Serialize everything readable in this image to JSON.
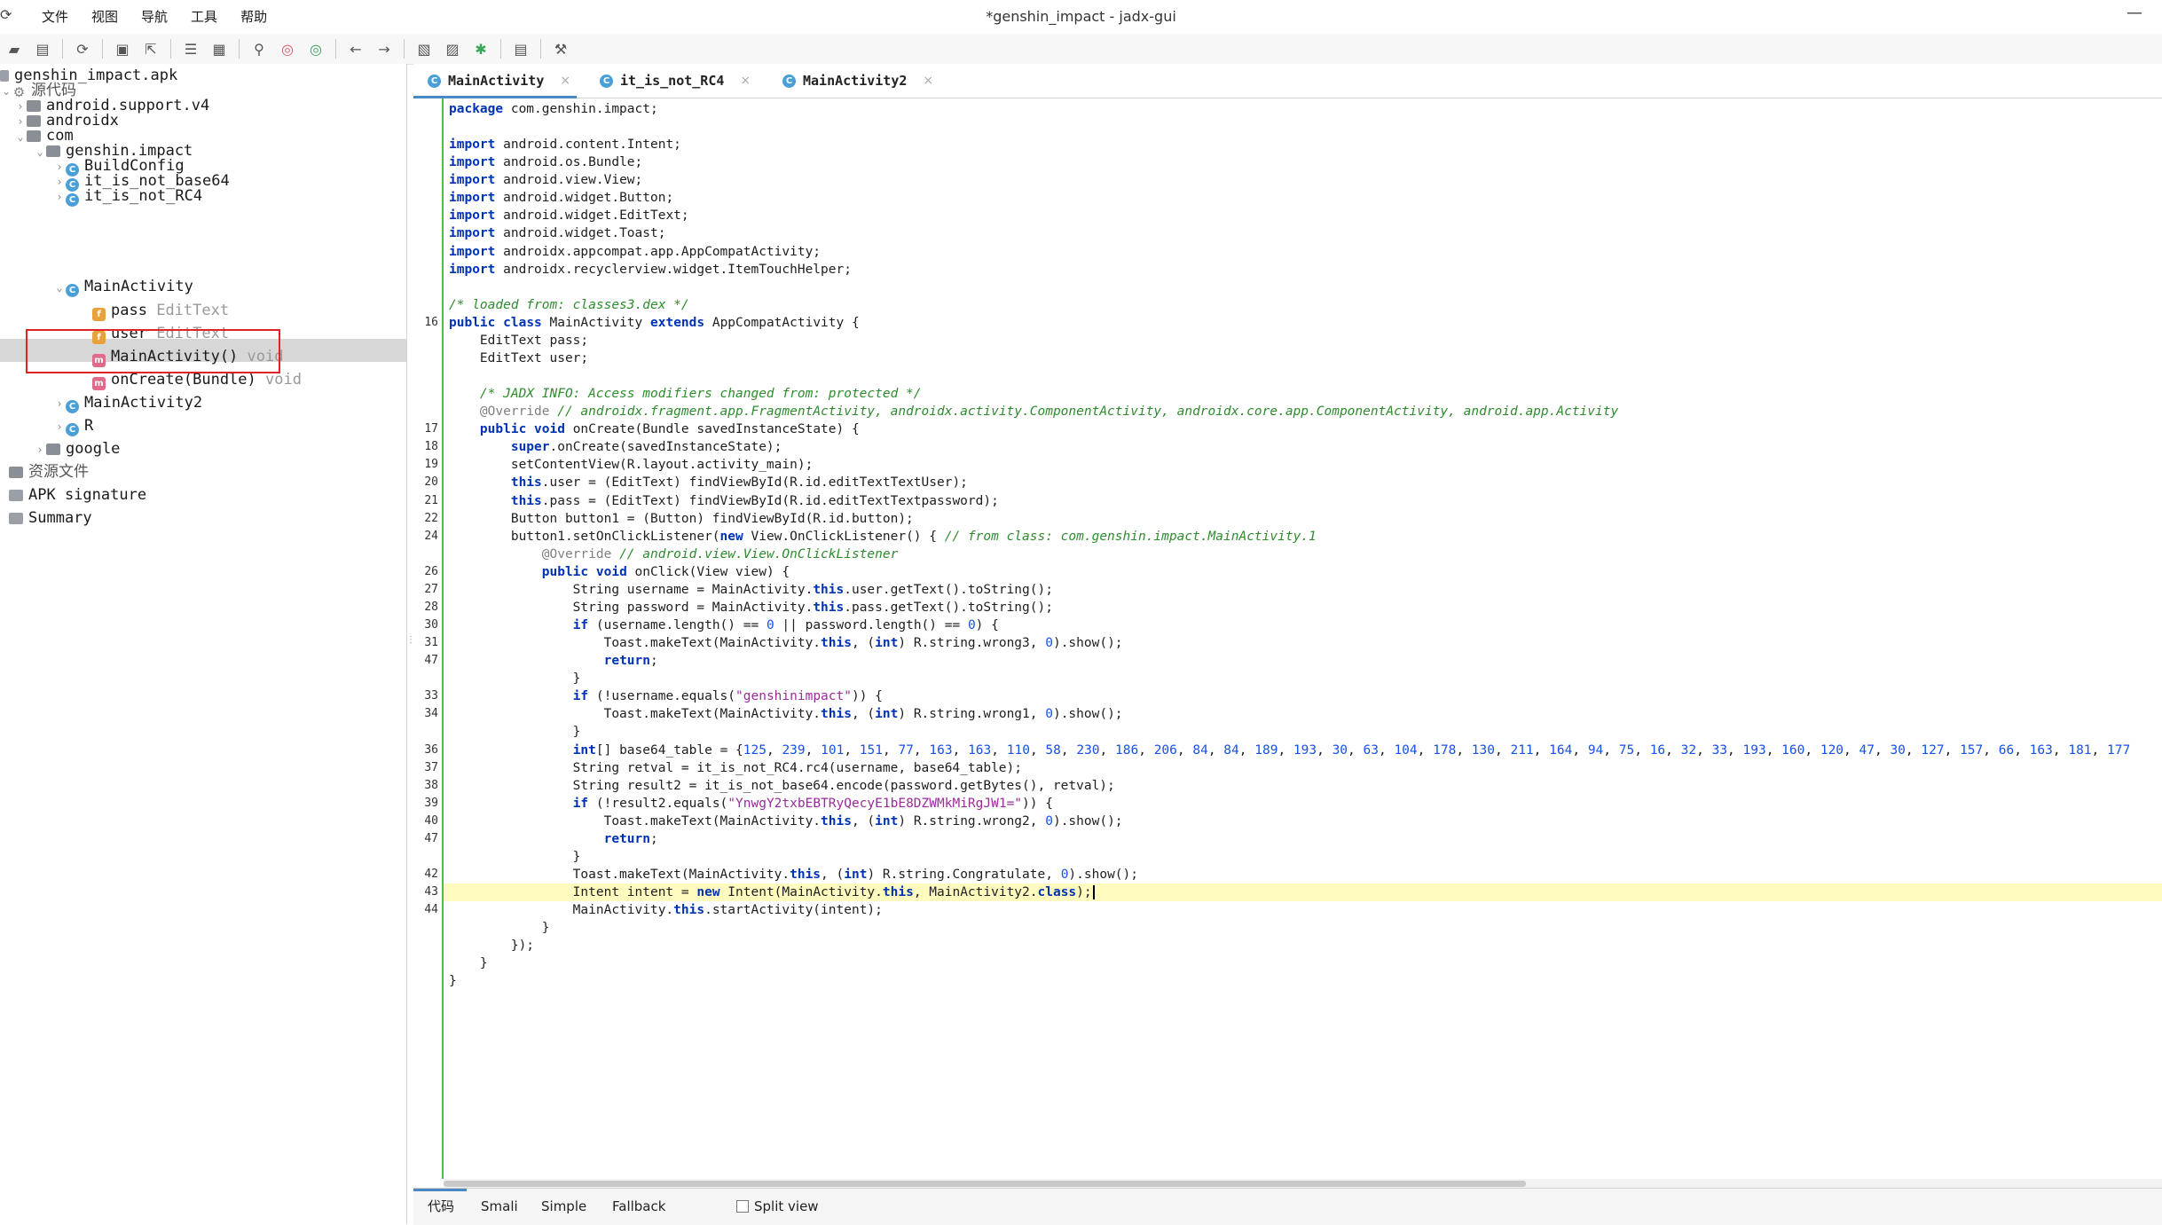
{
  "window": {
    "title": "*genshin_impact - jadx-gui",
    "minimize_glyph": "—"
  },
  "menu": [
    "文件",
    "视图",
    "导航",
    "工具",
    "帮助"
  ],
  "toolbar_icons": [
    "open-file",
    "add-files",
    "reload",
    "save-all",
    "export",
    "sync",
    "flatten-packages",
    "search",
    "find-usage",
    "find-class",
    "back",
    "forward",
    "goto",
    "bookmark",
    "debug",
    "log",
    "preferences"
  ],
  "tree": {
    "root": "genshin_impact.apk",
    "source_code": "源代码",
    "pkg_support": "android.support.v4",
    "pkg_androidx": "androidx",
    "pkg_com": "com",
    "pkg_genshin": "genshin.impact",
    "cls_buildconfig": "BuildConfig",
    "cls_base64": "it_is_not_base64",
    "cls_rc4": "it_is_not_RC4",
    "cls_main": "MainActivity",
    "field_pass": "pass",
    "field_pass_type": "EditText",
    "field_user": "user",
    "field_user_type": "EditText",
    "method_ctor": "MainActivity()",
    "method_ctor_type": "void",
    "method_oncreate": "onCreate(Bundle)",
    "method_oncreate_type": "void",
    "cls_main2": "MainActivity2",
    "cls_r": "R",
    "pkg_google": "google",
    "resources": "资源文件",
    "apk_signature": "APK signature",
    "summary": "Summary"
  },
  "tabs": [
    {
      "label": "MainActivity",
      "active": true
    },
    {
      "label": "it_is_not_RC4",
      "active": false
    },
    {
      "label": "MainActivity2",
      "active": false
    }
  ],
  "bottom_tabs": [
    "代码",
    "Smali",
    "Simple",
    "Fallback"
  ],
  "split_view_label": "Split view",
  "code": {
    "lines": [
      {
        "n": "",
        "t": "package com.genshin.impact;"
      },
      {
        "n": "",
        "t": ""
      },
      {
        "n": "",
        "t": "import android.content.Intent;"
      },
      {
        "n": "",
        "t": "import android.os.Bundle;"
      },
      {
        "n": "",
        "t": "import android.view.View;"
      },
      {
        "n": "",
        "t": "import android.widget.Button;"
      },
      {
        "n": "",
        "t": "import android.widget.EditText;"
      },
      {
        "n": "",
        "t": "import android.widget.Toast;"
      },
      {
        "n": "",
        "t": "import androidx.appcompat.app.AppCompatActivity;"
      },
      {
        "n": "",
        "t": "import androidx.recyclerview.widget.ItemTouchHelper;"
      },
      {
        "n": "",
        "t": ""
      },
      {
        "n": "",
        "t": "/* loaded from: classes3.dex */"
      },
      {
        "n": "16",
        "t": "public class MainActivity extends AppCompatActivity {"
      },
      {
        "n": "",
        "t": "    EditText pass;"
      },
      {
        "n": "",
        "t": "    EditText user;"
      },
      {
        "n": "",
        "t": ""
      },
      {
        "n": "",
        "t": "    /* JADX INFO: Access modifiers changed from: protected */"
      },
      {
        "n": "",
        "t": "    @Override // androidx.fragment.app.FragmentActivity, androidx.activity.ComponentActivity, androidx.core.app.ComponentActivity, android.app.Activity"
      },
      {
        "n": "17",
        "t": "    public void onCreate(Bundle savedInstanceState) {"
      },
      {
        "n": "18",
        "t": "        super.onCreate(savedInstanceState);"
      },
      {
        "n": "19",
        "t": "        setContentView(R.layout.activity_main);"
      },
      {
        "n": "20",
        "t": "        this.user = (EditText) findViewById(R.id.editTextTextUser);"
      },
      {
        "n": "21",
        "t": "        this.pass = (EditText) findViewById(R.id.editTextTextpassword);"
      },
      {
        "n": "22",
        "t": "        Button button1 = (Button) findViewById(R.id.button);"
      },
      {
        "n": "24",
        "t": "        button1.setOnClickListener(new View.OnClickListener() { // from class: com.genshin.impact.MainActivity.1"
      },
      {
        "n": "",
        "t": "            @Override // android.view.View.OnClickListener"
      },
      {
        "n": "26",
        "t": "            public void onClick(View view) {"
      },
      {
        "n": "27",
        "t": "                String username = MainActivity.this.user.getText().toString();"
      },
      {
        "n": "28",
        "t": "                String password = MainActivity.this.pass.getText().toString();"
      },
      {
        "n": "30",
        "t": "                if (username.length() == 0 || password.length() == 0) {"
      },
      {
        "n": "31",
        "t": "                    Toast.makeText(MainActivity.this, (int) R.string.wrong3, 0).show();"
      },
      {
        "n": "47",
        "t": "                    return;"
      },
      {
        "n": "",
        "t": "                }"
      },
      {
        "n": "33",
        "t": "                if (!username.equals(\"genshinimpact\")) {"
      },
      {
        "n": "34",
        "t": "                    Toast.makeText(MainActivity.this, (int) R.string.wrong1, 0).show();"
      },
      {
        "n": "",
        "t": "                }"
      },
      {
        "n": "36",
        "t": "                int[] base64_table = {125, 239, 101, 151, 77, 163, 163, 110, 58, 230, 186, 206, 84, 84, 189, 193, 30, 63, 104, 178, 130, 211, 164, 94, 75, 16, 32, 33, 193, 160, 120, 47, 30, 127, 157, 66, 163, 181, 177"
      },
      {
        "n": "37",
        "t": "                String retval = it_is_not_RC4.rc4(username, base64_table);"
      },
      {
        "n": "38",
        "t": "                String result2 = it_is_not_base64.encode(password.getBytes(), retval);"
      },
      {
        "n": "39",
        "t": "                if (!result2.equals(\"YnwgY2txbEBTRyQecyE1bE8DZWMkMiRgJW1=\")) {"
      },
      {
        "n": "40",
        "t": "                    Toast.makeText(MainActivity.this, (int) R.string.wrong2, 0).show();"
      },
      {
        "n": "47",
        "t": "                    return;"
      },
      {
        "n": "",
        "t": "                }"
      },
      {
        "n": "42",
        "t": "                Toast.makeText(MainActivity.this, (int) R.string.Congratulate, 0).show();"
      },
      {
        "n": "43",
        "t": "                Intent intent = new Intent(MainActivity.this, MainActivity2.class);",
        "current": true
      },
      {
        "n": "44",
        "t": "                MainActivity.this.startActivity(intent);"
      },
      {
        "n": "",
        "t": "            }"
      },
      {
        "n": "",
        "t": "        });"
      },
      {
        "n": "",
        "t": "    }"
      },
      {
        "n": "",
        "t": "}"
      }
    ]
  },
  "colors": {
    "keyword": "#0033b3",
    "comment": "#2e8b2e",
    "string": "#9a2b9a",
    "number": "#1750eb",
    "current_line": "#fffbbf",
    "selection_box": "#e02424",
    "gutter_border": "#4fb84f"
  }
}
